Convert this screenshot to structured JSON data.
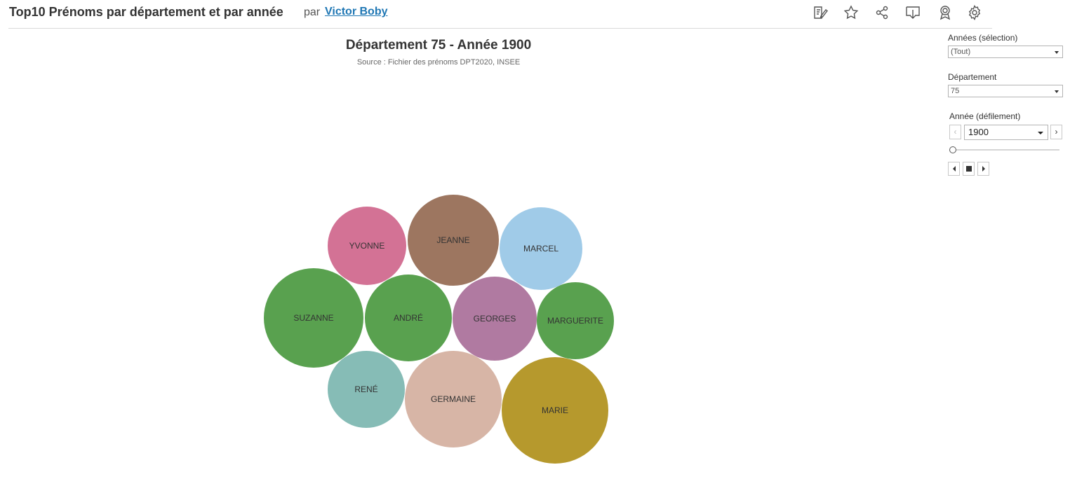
{
  "header": {
    "title": "Top10 Prénoms par département et par année",
    "by": "par",
    "author": "Victor Boby",
    "toolbar_icons": [
      "edit-icon",
      "favorite-star-icon",
      "share-icon",
      "download-icon",
      "badge-icon",
      "settings-gear-icon"
    ]
  },
  "chart": {
    "title": "Département 75 - Année 1900",
    "subtitle": "Source : Fichier des prénoms DPT2020, INSEE"
  },
  "filters": {
    "annees_label": "Années (sélection)",
    "annees_value": "(Tout)",
    "departement_label": "Département",
    "departement_value": "75",
    "defilement_label": "Année (défilement)",
    "defilement_value": "1900",
    "prev_glyph": "‹",
    "next_glyph": "›"
  },
  "chart_data": {
    "type": "bubble",
    "title": "Département 75 - Année 1900",
    "subtitle": "Source : Fichier des prénoms DPT2020, INSEE",
    "bubbles": [
      {
        "name": "YVONNE",
        "color": "#d37295"
      },
      {
        "name": "JEANNE",
        "color": "#9d7660"
      },
      {
        "name": "MARCEL",
        "color": "#a0cbe8"
      },
      {
        "name": "SUZANNE",
        "color": "#59a14f"
      },
      {
        "name": "ANDRÉ",
        "color": "#59a14f"
      },
      {
        "name": "GEORGES",
        "color": "#b07aa1"
      },
      {
        "name": "MARGUERITE",
        "color": "#59a14f"
      },
      {
        "name": "RENÉ",
        "color": "#86bcb6"
      },
      {
        "name": "GERMAINE",
        "color": "#d7b5a6"
      },
      {
        "name": "MARIE",
        "color": "#b6992d"
      }
    ]
  }
}
